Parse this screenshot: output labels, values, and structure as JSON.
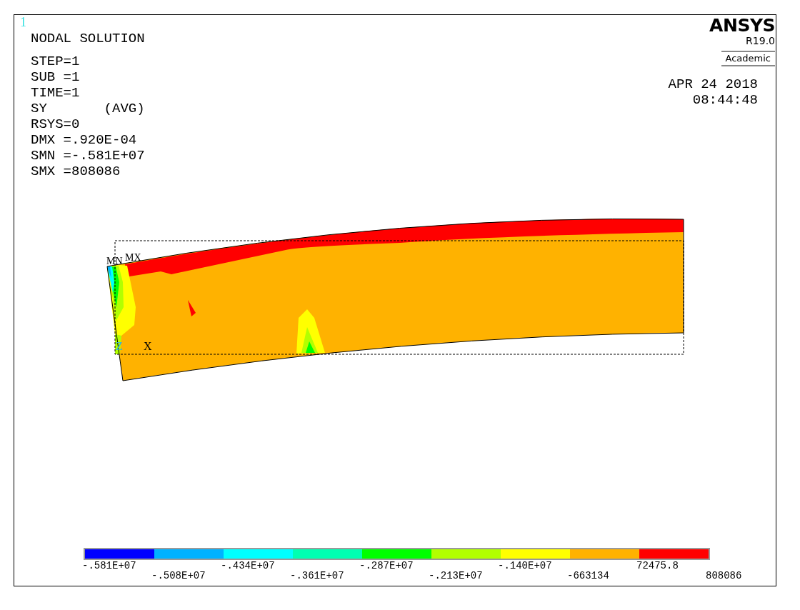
{
  "plot_number": "1",
  "title": "NODAL SOLUTION",
  "info_lines": [
    "STEP=1",
    "SUB =1",
    "TIME=1",
    "SY       (AVG)",
    "RSYS=0",
    "DMX =.920E-04",
    "SMN =-.581E+07",
    "SMX =808086"
  ],
  "logo": {
    "name": "ANSYS",
    "version": "R19.0",
    "edition": "Academic"
  },
  "date": "APR 24 2018",
  "time": "08:44:48",
  "markers": [
    {
      "label": "MN"
    },
    {
      "label": "MX"
    }
  ],
  "axes": [
    {
      "label": "Z"
    },
    {
      "label": "X"
    }
  ],
  "legend": {
    "bands": [
      {
        "color": "#0000ff"
      },
      {
        "color": "#00b2ff"
      },
      {
        "color": "#00ffff"
      },
      {
        "color": "#00ffb2"
      },
      {
        "color": "#00ff00"
      },
      {
        "color": "#b2ff00"
      },
      {
        "color": "#ffff00"
      },
      {
        "color": "#ffb200"
      },
      {
        "color": "#ff0000"
      }
    ],
    "labels": [
      "-.581E+07",
      "-.508E+07",
      "-.434E+07",
      "-.361E+07",
      "-.287E+07",
      "-.213E+07",
      "-.140E+07",
      "-663134",
      "72475.8",
      "808086"
    ]
  }
}
